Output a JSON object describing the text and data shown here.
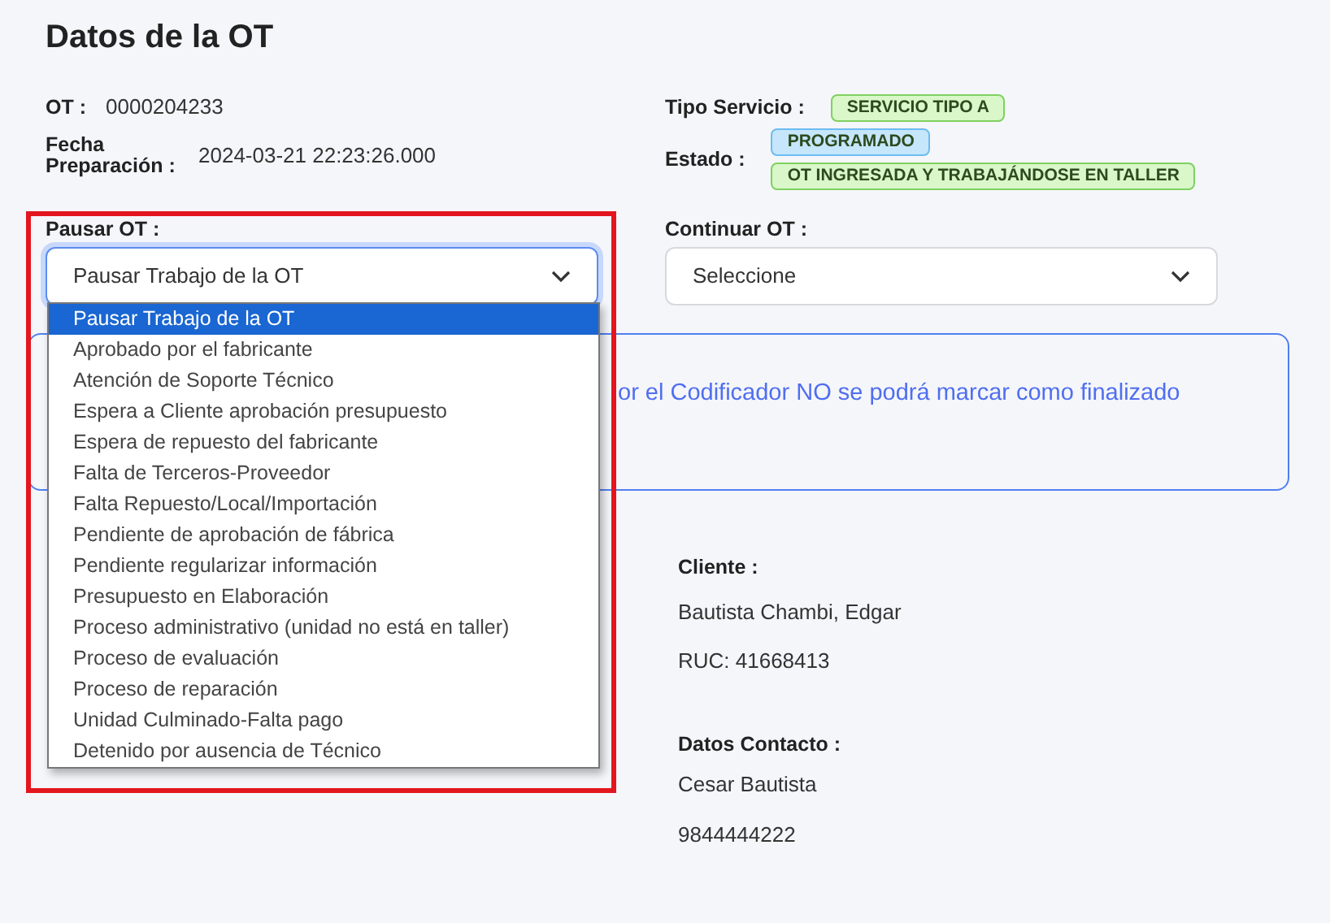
{
  "title": "Datos de la OT",
  "ot": {
    "label": "OT :",
    "value": "0000204233"
  },
  "fecha": {
    "label": "Fecha Preparación :",
    "value": "2024-03-21 22:23:26.000"
  },
  "tipo_servicio": {
    "label": "Tipo Servicio :",
    "badges": [
      {
        "text": "SERVICIO TIPO A",
        "color": "#d9f7c9"
      }
    ]
  },
  "estado": {
    "label": "Estado :",
    "badges": [
      {
        "text": "PROGRAMADO",
        "color": "#c5e6fb"
      },
      {
        "text": "OT INGRESADA Y TRABAJÁNDOSE EN TALLER",
        "color": "#d9f7c9"
      }
    ]
  },
  "pausar": {
    "label": "Pausar OT :",
    "value": "Pausar Trabajo de la OT",
    "expanded": true,
    "options": [
      {
        "label": "Pausar Trabajo de la OT",
        "selected": true
      },
      {
        "label": "Aprobado por el fabricante",
        "selected": false
      },
      {
        "label": "Atención de Soporte Técnico",
        "selected": false
      },
      {
        "label": "Espera a Cliente aprobación presupuesto",
        "selected": false
      },
      {
        "label": "Espera de repuesto del fabricante",
        "selected": false
      },
      {
        "label": "Falta de Terceros-Proveedor",
        "selected": false
      },
      {
        "label": "Falta Repuesto/Local/Importación",
        "selected": false
      },
      {
        "label": "Pendiente de aprobación de fábrica",
        "selected": false
      },
      {
        "label": "Pendiente regularizar información",
        "selected": false
      },
      {
        "label": "Presupuesto en Elaboración",
        "selected": false
      },
      {
        "label": "Proceso administrativo (unidad no está en taller)",
        "selected": false
      },
      {
        "label": "Proceso de evaluación",
        "selected": false
      },
      {
        "label": "Proceso de reparación",
        "selected": false
      },
      {
        "label": "Unidad Culminado-Falta pago",
        "selected": false
      },
      {
        "label": "Detenido por ausencia de Técnico",
        "selected": false
      }
    ]
  },
  "continuar": {
    "label": "Continuar OT :",
    "value": "Seleccione",
    "expanded": false
  },
  "alert": {
    "text": "or el Codificador NO se podrá marcar como finalizado"
  },
  "cliente": {
    "label": "Cliente :",
    "name": "Bautista Chambi, Edgar",
    "ruc": "RUC: 41668413"
  },
  "contacto": {
    "label": "Datos Contacto :",
    "name": "Cesar Bautista",
    "phone": "9844444222"
  }
}
